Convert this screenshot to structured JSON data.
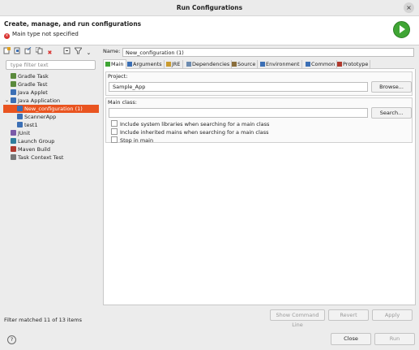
{
  "window": {
    "title": "Run Configurations",
    "close": "×"
  },
  "header": {
    "heading": "Create, manage, and run configurations",
    "error": "Main type not specified",
    "error_icon": "×"
  },
  "toolbar": {
    "icons": [
      "new-launch-config-icon",
      "new-prototype-icon",
      "export-icon",
      "duplicate-icon",
      "delete-icon",
      "collapse-all-icon",
      "filter-icon",
      "view-menu-icon"
    ],
    "delete_glyph": "✖",
    "view_menu_glyph": "⌄"
  },
  "filter": {
    "placeholder": "type filter text"
  },
  "tree": [
    {
      "label": "Gradle Task",
      "level": 0,
      "color": "#5a8a3c"
    },
    {
      "label": "Gradle Test",
      "level": 0,
      "color": "#5a8a3c"
    },
    {
      "label": "Java Applet",
      "level": 0,
      "color": "#3b6fb5"
    },
    {
      "label": "Java Application",
      "level": 0,
      "color": "#3b6fb5",
      "expanded": true,
      "expander": "⌄"
    },
    {
      "label": "New_configuration (1)",
      "level": 1,
      "color": "#3b6fb5",
      "selected": true
    },
    {
      "label": "ScannerApp",
      "level": 1,
      "color": "#3b6fb5"
    },
    {
      "label": "test1",
      "level": 1,
      "color": "#3b6fb5"
    },
    {
      "label": "JUnit",
      "level": 0,
      "color": "#7a5aa8"
    },
    {
      "label": "Launch Group",
      "level": 0,
      "color": "#2f7d9c"
    },
    {
      "label": "Maven Build",
      "level": 0,
      "color": "#b03a2e"
    },
    {
      "label": "Task Context Test",
      "level": 0,
      "color": "#777777"
    }
  ],
  "filter_info": "Filter matched 11 of 13 items",
  "config": {
    "name_label": "Name:",
    "name_value": "New_configuration (1)",
    "tabs": [
      "Main",
      "Arguments",
      "JRE",
      "Dependencies",
      "Source",
      "Environment",
      "Common",
      "Prototype"
    ],
    "project_label": "Project:",
    "project_value": "Sample_App",
    "browse": "Browse...",
    "main_class_label": "Main class:",
    "main_class_value": "",
    "search": "Search...",
    "options": [
      "Include system libraries when searching for a main class",
      "Include inherited mains when searching for a main class",
      "Stop in main"
    ]
  },
  "actions": {
    "show_command_line": "Show Command Line",
    "revert": "Revert",
    "apply": "Apply"
  },
  "footer": {
    "help": "?",
    "close": "Close",
    "run": "Run"
  },
  "colors": {
    "selection": "#e95420",
    "run_green": "#3fa534",
    "error_red": "#d9322f"
  }
}
